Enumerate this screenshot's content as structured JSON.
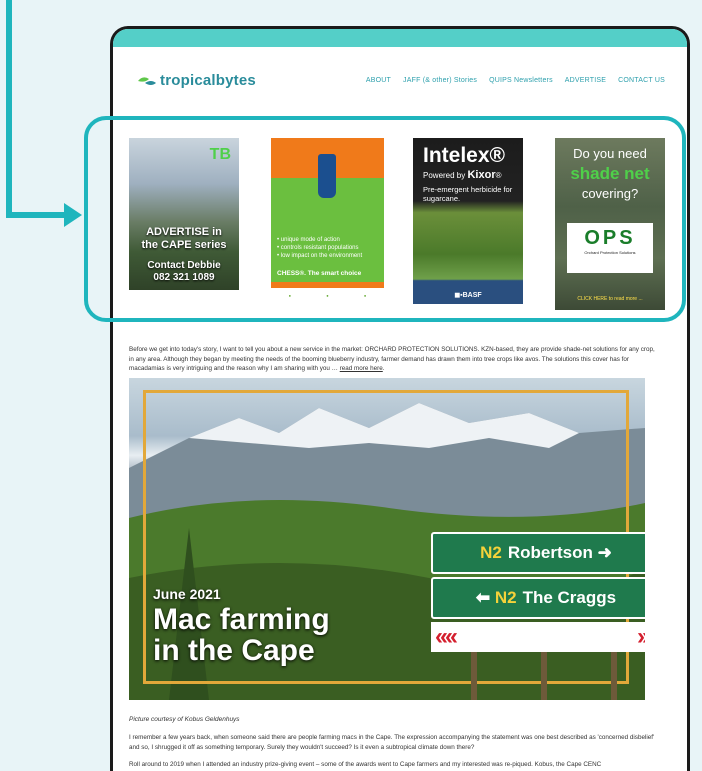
{
  "site": {
    "logo_text": "tropicalbytes",
    "nav": [
      "ABOUT",
      "JAFF (& other) Stories",
      "QUIPS Newsletters",
      "ADVERTISE",
      "CONTACT US"
    ]
  },
  "ads": {
    "ad1": {
      "badge": "TB",
      "line1": "ADVERTISE in",
      "line2": "the CAPE series",
      "line3": "Contact Debbie",
      "line4": "082 321 1089"
    },
    "ad2": {
      "bullets": [
        "unique mode of action",
        "controls resistant populations",
        "low impact on the environment"
      ],
      "slogan": "CHESS®. The smart choice"
    },
    "ad3": {
      "name": "Intelex",
      "powered": "Powered by",
      "brand": "Kixor",
      "desc": "Pre-emergent herbicide for sugarcane.",
      "maker": "BASF"
    },
    "ad4": {
      "line1": "Do you need",
      "line2": "shade net",
      "line3": "covering?",
      "logo": "OPS",
      "company": "Orchard Protection Solutions",
      "cta": "CLICK HERE to read more ..."
    }
  },
  "article": {
    "intro": "Before we get into today's story, I want to tell you about a new service in the market: ORCHARD PROTECTION SOLUTIONS. KZN-based, they are provide shade-net solutions for any crop, in any area. Although they began by meeting the needs of the booming blueberry industry, farmer demand has drawn them into tree crops like avos. The solutions this cover has for macadamias is very intriguing and the reason why I am sharing with you …",
    "read_more": "read more here",
    "hero_date": "June 2021",
    "hero_title_1": "Mac farming",
    "hero_title_2": "in the Cape",
    "sign_row1_code": "N2",
    "sign_row1_place": "Robertson",
    "sign_row2_code": "N2",
    "sign_row2_place": "The Craggs",
    "caption": "Picture courtesy of Kobus Geldenhuys",
    "para1": "I remember a few years back, when someone said there are people farming macs in the Cape. The expression accompanying the statement was one best described as 'concerned disbelief' and so, I shrugged it off as something temporary. Surely they wouldn't succeed? Is it even a subtropical climate down there?",
    "para2": "Roll around to 2019 when I attended an industry prize-giving event – some of the awards went to Cape farmers and my interested was re-piqued. Kobus, the Cape CENC"
  }
}
